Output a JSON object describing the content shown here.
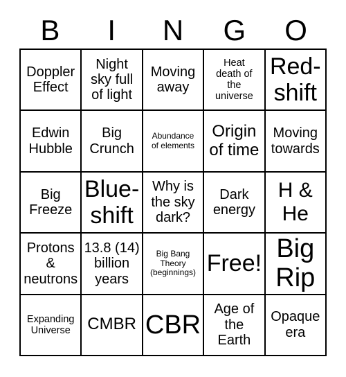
{
  "card": {
    "header_letters": [
      "B",
      "I",
      "N",
      "G",
      "O"
    ],
    "free_space_label": "Free!",
    "grid": [
      [
        {
          "text": "Doppler\nEffect",
          "size": "md"
        },
        {
          "text": "Night\nsky full\nof light",
          "size": "md"
        },
        {
          "text": "Moving\naway",
          "size": "md"
        },
        {
          "text": "Heat\ndeath of\nthe\nuniverse",
          "size": "sm"
        },
        {
          "text": "Red-\nshift",
          "size": "xxl"
        }
      ],
      [
        {
          "text": "Edwin\nHubble",
          "size": "md"
        },
        {
          "text": "Big\nCrunch",
          "size": "md"
        },
        {
          "text": "Abundance\nof elements",
          "size": "xs"
        },
        {
          "text": "Origin\nof time",
          "size": "lg"
        },
        {
          "text": "Moving\ntowards",
          "size": "md"
        }
      ],
      [
        {
          "text": "Big\nFreeze",
          "size": "md"
        },
        {
          "text": "Blue-\nshift",
          "size": "xxl"
        },
        {
          "text": "Why is\nthe sky\ndark?",
          "size": "md"
        },
        {
          "text": "Dark\nenergy",
          "size": "md"
        },
        {
          "text": "H &\nHe",
          "size": "xl"
        }
      ],
      [
        {
          "text": "Protons\n&\nneutrons",
          "size": "md"
        },
        {
          "text": "13.8 (14)\nbillion\nyears",
          "size": "md"
        },
        {
          "text": "Big Bang\nTheory\n(beginnings)",
          "size": "xs"
        },
        {
          "text": "Free!",
          "size": "xxl"
        },
        {
          "text": "Big\nRip",
          "size": "huge"
        }
      ],
      [
        {
          "text": "Expanding\nUniverse",
          "size": "sm"
        },
        {
          "text": "CMBR",
          "size": "lg"
        },
        {
          "text": "CBR",
          "size": "huge"
        },
        {
          "text": "Age of\nthe\nEarth",
          "size": "md"
        },
        {
          "text": "Opaque\nera",
          "size": "md"
        }
      ]
    ]
  },
  "colors": {
    "background": "#ffffff",
    "text": "#000000",
    "grid_line": "#000000"
  }
}
